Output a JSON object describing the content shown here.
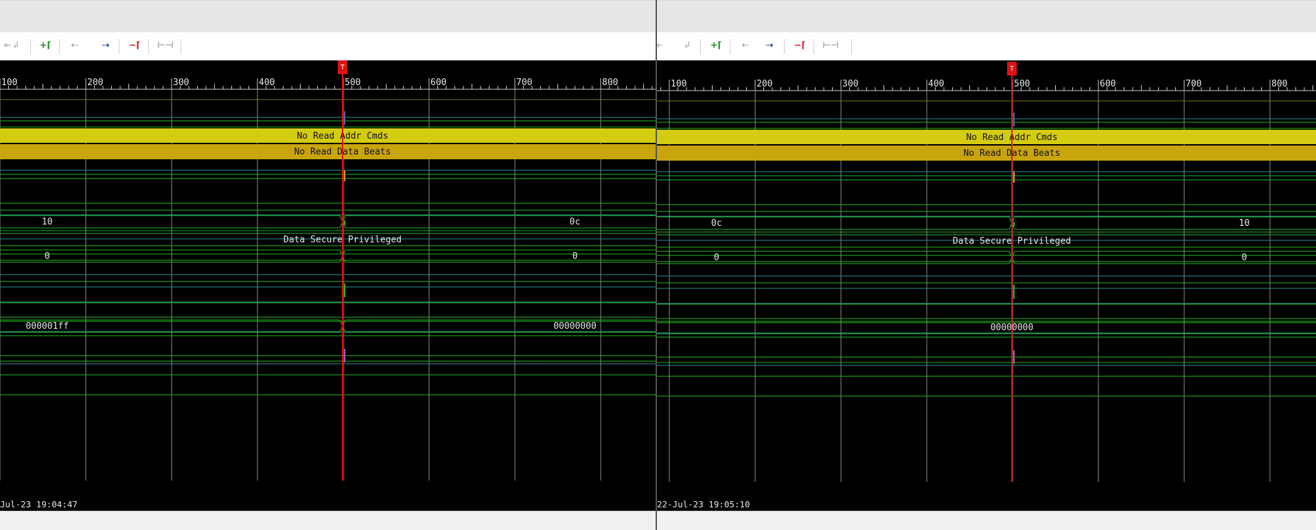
{
  "panes": [
    {
      "id": "left",
      "timestamp": "Jul-23 19:04:47",
      "ruler_ticks": [
        "100",
        "200",
        "300",
        "400",
        "500",
        "600",
        "700",
        "800"
      ],
      "cursor_label": "T",
      "bands": [
        {
          "label": "No Read Addr Cmds"
        },
        {
          "label": "No Read Data Beats"
        }
      ],
      "bus_values": {
        "row1": {
          "before": "10",
          "after": "0c"
        },
        "row2": {
          "text": "Data Secure Privileged"
        },
        "row3": {
          "before": "0",
          "after": "0"
        },
        "row4": {
          "before": "000001ff",
          "after": "00000000"
        }
      }
    },
    {
      "id": "right",
      "timestamp": "22-Jul-23 19:05:10",
      "ruler_ticks": [
        "100",
        "200",
        "300",
        "400",
        "500",
        "600",
        "700",
        "800"
      ],
      "cursor_label": "T",
      "bands": [
        {
          "label": "No Read Addr Cmds"
        },
        {
          "label": "No Read Data Beats"
        }
      ],
      "bus_values": {
        "row1": {
          "before": "0c",
          "after": "10"
        },
        "row2": {
          "text": "Data Secure Privileged"
        },
        "row3": {
          "before": "0",
          "after": "0"
        },
        "row4": {
          "text": "00000000"
        }
      }
    }
  ],
  "colors": {
    "background": "#000000",
    "grid": "#8c8c8c",
    "signal": "#22bb22",
    "band1": "#d4cc10",
    "band2": "#c9a50d",
    "cursor": "#dd1111",
    "teal": "#2f8f8f"
  },
  "toolbar_icons": [
    "step-back-icon",
    "step-edge-icon",
    "add-marker-icon",
    "prev-edge-icon",
    "next-edge-icon",
    "remove-marker-icon",
    "zoom-fit-icon"
  ]
}
